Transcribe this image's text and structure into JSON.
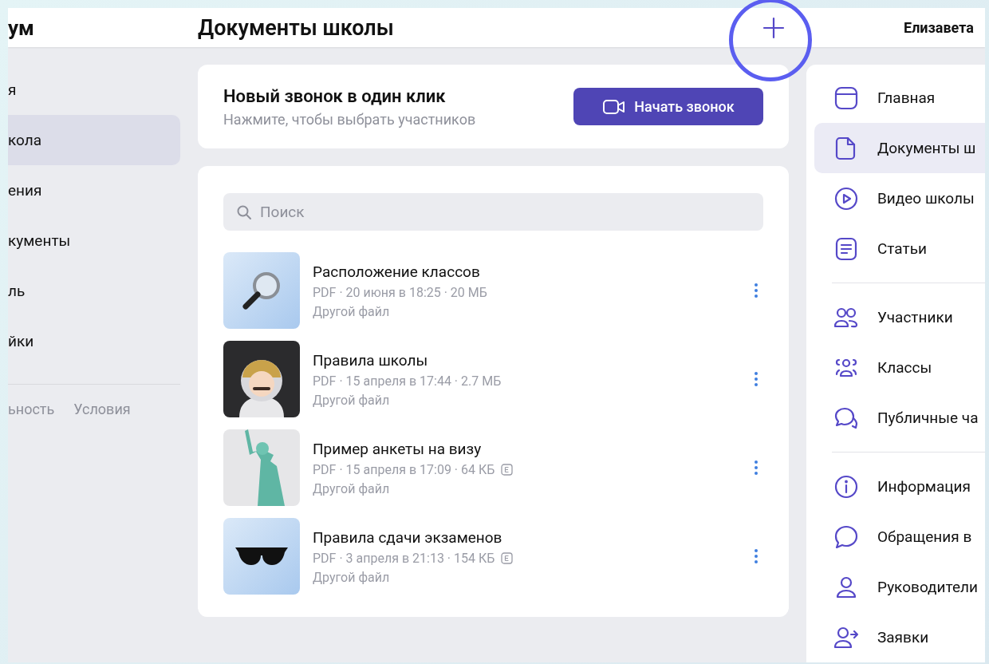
{
  "header": {
    "logo": "ум",
    "title": "Документы школы",
    "user_name": "Елизавета"
  },
  "sidebar": {
    "items": [
      {
        "label": "я",
        "selected": false
      },
      {
        "label": "кола",
        "selected": true
      },
      {
        "label": "ения",
        "selected": false
      },
      {
        "label": "кументы",
        "selected": false
      },
      {
        "label": "ль",
        "selected": false
      },
      {
        "label": "йки",
        "selected": false
      }
    ],
    "footer_links": [
      "ьность",
      "Условия"
    ]
  },
  "call_card": {
    "title": "Новый звонок в один клик",
    "subtitle": "Нажмите, чтобы выбрать участников",
    "button": "Начать звонок"
  },
  "search": {
    "placeholder": "Поиск"
  },
  "files": [
    {
      "name": "Расположение классов",
      "meta": "PDF · 20 июня в 18:25 · 20 МБ",
      "category": "Другой файл",
      "kind": "magnifier",
      "badge": false
    },
    {
      "name": "Правила школы",
      "meta": "PDF · 15 апреля в 17:44 · 2.7 МБ",
      "category": "Другой файл",
      "kind": "astronaut",
      "badge": false
    },
    {
      "name": "Пример анкеты на визу",
      "meta": "PDF · 15 апреля в 17:09 · 64 КБ",
      "category": "Другой файл",
      "kind": "statue",
      "badge": true
    },
    {
      "name": "Правила сдачи экзаменов",
      "meta": "PDF · 3 апреля в 21:13 · 154 КБ",
      "category": "Другой файл",
      "kind": "sunglasses",
      "badge": true
    }
  ],
  "nav": {
    "groups": [
      [
        {
          "label": "Главная",
          "kind": "window",
          "selected": false
        },
        {
          "label": "Документы ш",
          "kind": "document",
          "selected": true
        },
        {
          "label": "Видео школы",
          "kind": "play",
          "selected": false
        },
        {
          "label": "Статьи",
          "kind": "article",
          "selected": false
        }
      ],
      [
        {
          "label": "Участники",
          "kind": "people",
          "selected": false
        },
        {
          "label": "Классы",
          "kind": "group",
          "selected": false
        },
        {
          "label": "Публичные ча",
          "kind": "chats",
          "selected": false
        }
      ],
      [
        {
          "label": "Информация",
          "kind": "info",
          "selected": false
        },
        {
          "label": "Обращения в",
          "kind": "chat",
          "selected": false
        },
        {
          "label": "Руководители",
          "kind": "person",
          "selected": false
        },
        {
          "label": "Заявки",
          "kind": "person-arrow",
          "selected": false
        }
      ]
    ]
  }
}
